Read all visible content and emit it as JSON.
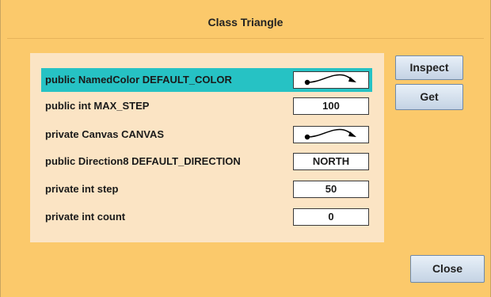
{
  "window": {
    "title": "Class Triangle"
  },
  "fields": [
    {
      "label": "public NamedColor DEFAULT_COLOR",
      "value": "",
      "value_icon": "object-reference-arrow-icon",
      "selected": true
    },
    {
      "label": "public int MAX_STEP",
      "value": "100"
    },
    {
      "label": "private Canvas CANVAS",
      "value": "",
      "value_icon": "object-reference-arrow-icon"
    },
    {
      "label": "public Direction8 DEFAULT_DIRECTION",
      "value": "NORTH"
    },
    {
      "label": "private int step",
      "value": "50"
    },
    {
      "label": "private int count",
      "value": "0"
    }
  ],
  "buttons": {
    "inspect": "Inspect",
    "get": "Get",
    "close": "Close"
  },
  "colors": {
    "window_bg": "#fbc96b",
    "panel_bg": "#fbe4c4",
    "selection": "#26c2c4"
  }
}
